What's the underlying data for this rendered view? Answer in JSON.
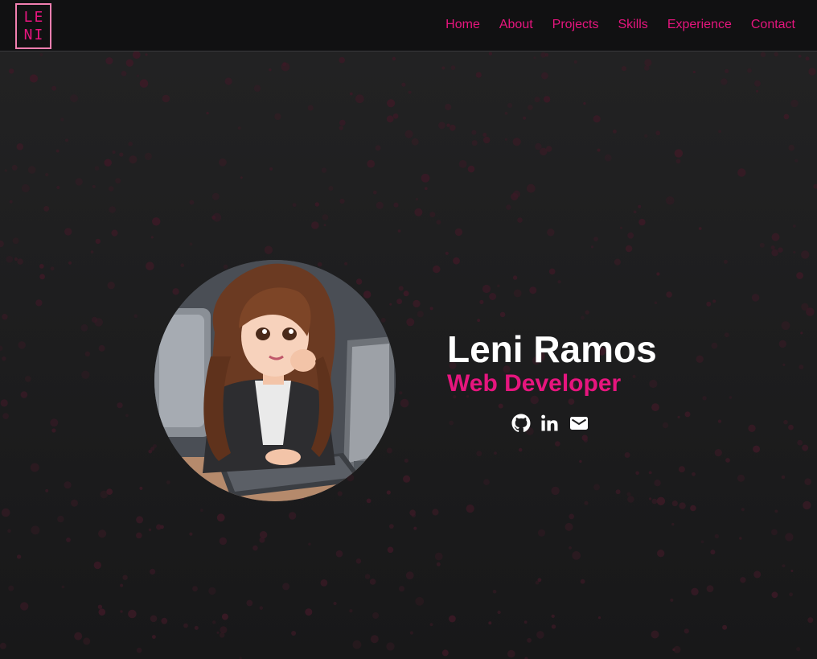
{
  "logo": {
    "line1": "LE",
    "line2": "NI"
  },
  "nav": {
    "items": [
      {
        "label": "Home"
      },
      {
        "label": "About"
      },
      {
        "label": "Projects"
      },
      {
        "label": "Skills"
      },
      {
        "label": "Experience"
      },
      {
        "label": "Contact"
      }
    ]
  },
  "hero": {
    "name": "Leni Ramos",
    "role": "Web Developer",
    "avatar_icon": "developer-girl-illustration",
    "socials": [
      {
        "icon": "github-icon"
      },
      {
        "icon": "linkedin-icon"
      },
      {
        "icon": "email-icon"
      }
    ]
  },
  "colors": {
    "accent": "#e6157e",
    "navbar_bg": "#111112",
    "page_bg": "#1e1e1f",
    "particle": "#3b1a26",
    "text_primary": "#ffffff"
  }
}
